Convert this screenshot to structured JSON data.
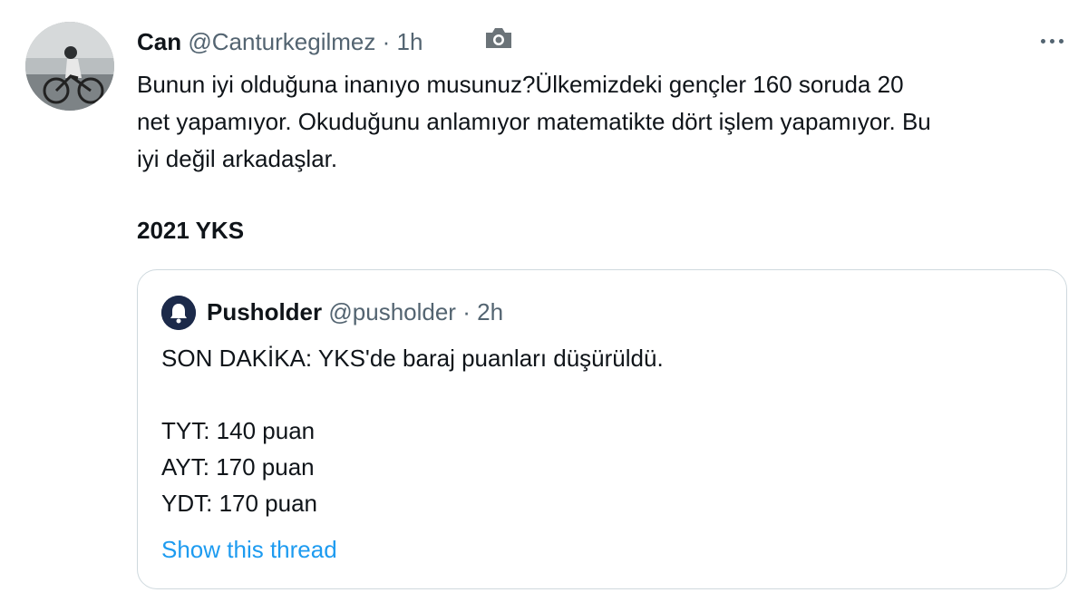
{
  "tweet": {
    "display_name": "Can",
    "handle": "@Canturkegilmez",
    "separator": "·",
    "time": "1h",
    "body_lines": [
      "Bunun iyi olduğuna inanıyo musunuz?Ülkemizdeki gençler 160 soruda 20",
      "net yapamıyor. Okuduğunu anlamıyor matematikte dört işlem yapamıyor. Bu",
      "iyi değil arkadaşlar."
    ],
    "bold_line": "2021 YKS",
    "icons": {
      "avatar": "avatar-cyclist-photo",
      "camera": "camera-icon",
      "more": "more-options-icon"
    }
  },
  "quote": {
    "display_name": "Pusholder",
    "handle": "@pusholder",
    "separator": "·",
    "time": "2h",
    "headline": "SON DAKİKA: YKS'de baraj puanları düşürüldü.",
    "lines": [
      "TYT: 140 puan",
      "AYT: 170 puan",
      "YDT: 170 puan"
    ],
    "show_thread": "Show this thread",
    "icons": {
      "avatar": "pusholder-bell-logo"
    }
  },
  "colors": {
    "text_primary": "#0f1419",
    "text_secondary": "#536471",
    "link": "#1d9bf0",
    "border": "#cfd9de",
    "background": "#ffffff"
  }
}
